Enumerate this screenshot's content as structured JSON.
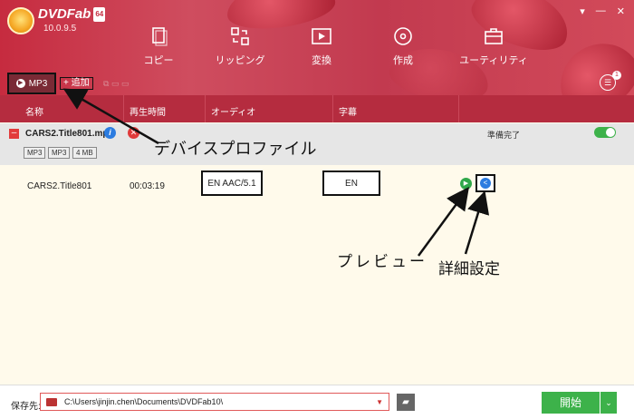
{
  "app": {
    "name": "DVDFab",
    "badge": "64",
    "version": "10.0.9.5"
  },
  "window_controls": [
    "▾",
    "—",
    "✕"
  ],
  "nav": {
    "items": [
      {
        "label": "コピー",
        "icon": "copy-icon"
      },
      {
        "label": "リッピング",
        "icon": "ripper-icon"
      },
      {
        "label": "変換",
        "icon": "converter-icon"
      },
      {
        "label": "作成",
        "icon": "creator-icon"
      },
      {
        "label": "ユーティリティ",
        "icon": "toolbox-icon"
      }
    ]
  },
  "toolbar": {
    "profile_label": "MP3",
    "add_label": "追加",
    "list_badge": "1"
  },
  "columns": {
    "name": "名称",
    "duration": "再生時間",
    "audio": "オーディオ",
    "subtitle": "字幕"
  },
  "title_row": {
    "filename": "CARS2.Title801.mp4",
    "tags": [
      "MP3",
      "MP3",
      "4 MB"
    ],
    "status": "準備完了"
  },
  "track": {
    "name": "CARS2.Title801",
    "duration": "00:03:19",
    "audio": "EN AAC/5.1",
    "subtitle": "EN"
  },
  "annotations": {
    "profile": "デバイスプロファイル",
    "preview": "プレビュー",
    "advanced": "詳細設定"
  },
  "bottom": {
    "save_label": "保存先:",
    "path": "C:\\Users\\jinjin.chen\\Documents\\DVDFab10\\",
    "start_label": "開始"
  },
  "colors": {
    "header": "#c62b3f",
    "column_header": "#b52c3f",
    "start": "#3db24a"
  }
}
